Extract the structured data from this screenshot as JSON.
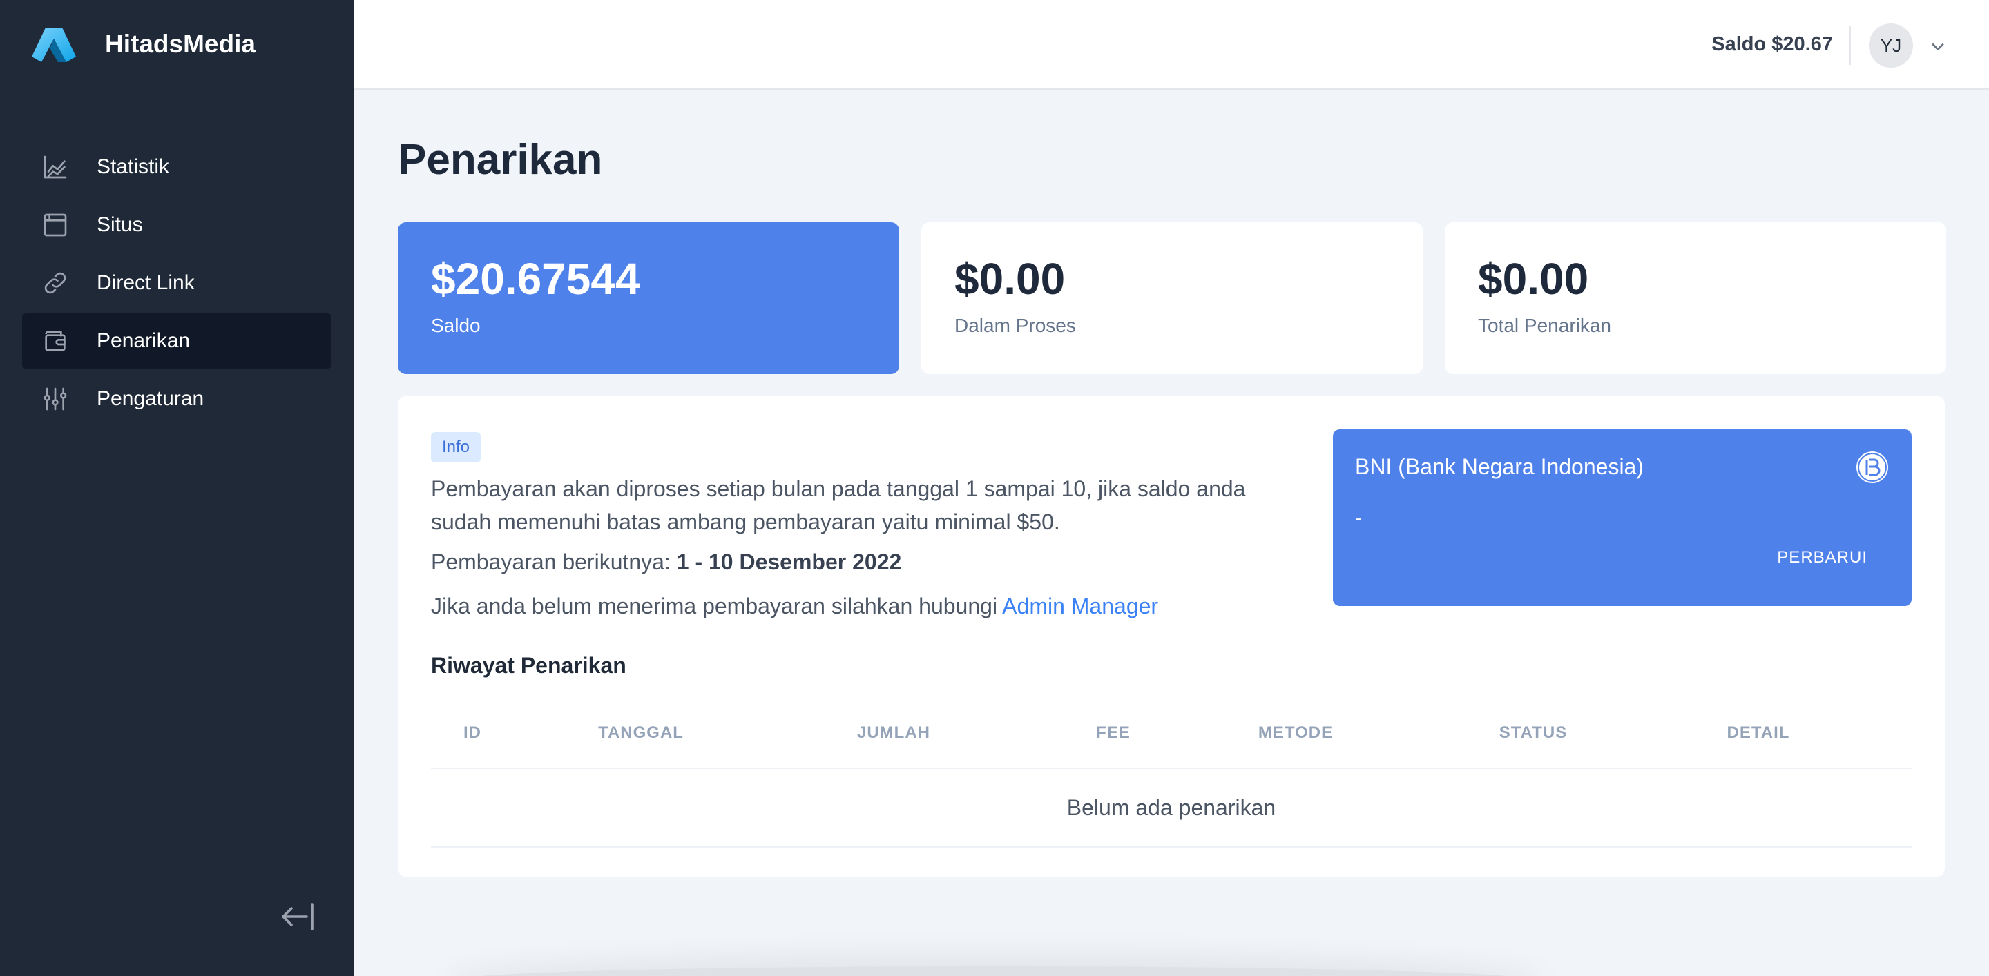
{
  "brand": {
    "name": "HitadsMedia",
    "logo_icon": "hitadsmedia-logo"
  },
  "sidebar": {
    "items": [
      {
        "label": "Statistik",
        "icon": "chart-line-icon",
        "active": false
      },
      {
        "label": "Situs",
        "icon": "browser-window-icon",
        "active": false
      },
      {
        "label": "Direct Link",
        "icon": "link-icon",
        "active": false
      },
      {
        "label": "Penarikan",
        "icon": "wallet-icon",
        "active": true
      },
      {
        "label": "Pengaturan",
        "icon": "sliders-icon",
        "active": false
      }
    ],
    "collapse_icon": "arrow-left-bar-icon"
  },
  "header": {
    "balance": "Saldo $20.67",
    "avatar_initials": "YJ"
  },
  "page": {
    "title": "Penarikan",
    "stats": [
      {
        "value": "$20.67544",
        "label": "Saldo"
      },
      {
        "value": "$0.00",
        "label": "Dalam Proses"
      },
      {
        "value": "$0.00",
        "label": "Total Penarikan"
      }
    ],
    "info": {
      "badge": "Info",
      "text": "Pembayaran akan diproses setiap bulan pada tanggal 1 sampai 10, jika saldo anda sudah memenuhi batas ambang pembayaran yaitu minimal $50.",
      "next_label": "Pembayaran berikutnya: ",
      "next_value": "1 - 10 Desember 2022",
      "contact_text": "Jika anda belum menerima pembayaran silahkan hubungi ",
      "contact_link": "Admin Manager"
    },
    "bank": {
      "name": "BNI (Bank Negara Indonesia)",
      "account": "-",
      "update_label": "PERBARUI",
      "logo_icon": "bank-logo-icon"
    },
    "history": {
      "title": "Riwayat Penarikan",
      "columns": [
        "ID",
        "TANGGAL",
        "JUMLAH",
        "FEE",
        "METODE",
        "STATUS",
        "DETAIL"
      ],
      "empty_text": "Belum ada penarikan"
    }
  },
  "colors": {
    "sidebar": "#1f2937",
    "sidebar_active": "#111827",
    "primary": "#4f81ea",
    "background": "#f1f5f9",
    "link": "#3b82f6"
  }
}
